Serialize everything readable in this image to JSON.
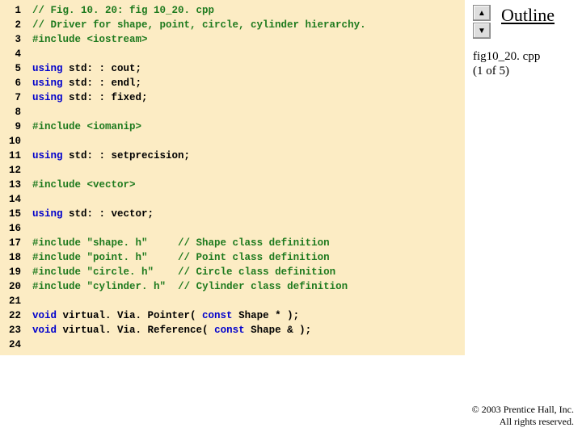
{
  "outline": {
    "title": "Outline",
    "file_label": "fig10_20. cpp",
    "page_label": "(1 of 5)"
  },
  "footer": {
    "copyright": "© 2003 Prentice Hall, Inc.",
    "rights": "All rights reserved."
  },
  "nav": {
    "up_icon": "▲",
    "down_icon": "▼"
  },
  "code": {
    "lines": [
      {
        "n": 1,
        "tokens": [
          {
            "c": "comment",
            "t": "// Fig. 10. 20: fig 10_20. cpp"
          }
        ]
      },
      {
        "n": 2,
        "tokens": [
          {
            "c": "comment",
            "t": "// Driver for shape, point, circle, cylinder hierarchy."
          }
        ]
      },
      {
        "n": 3,
        "tokens": [
          {
            "c": "pp",
            "t": "#include <iostream>"
          }
        ]
      },
      {
        "n": 4,
        "tokens": []
      },
      {
        "n": 5,
        "tokens": [
          {
            "c": "kw",
            "t": "using"
          },
          {
            "c": "plain",
            "t": " std: : cout;"
          }
        ]
      },
      {
        "n": 6,
        "tokens": [
          {
            "c": "kw",
            "t": "using"
          },
          {
            "c": "plain",
            "t": " std: : endl;"
          }
        ]
      },
      {
        "n": 7,
        "tokens": [
          {
            "c": "kw",
            "t": "using"
          },
          {
            "c": "plain",
            "t": " std: : fixed;"
          }
        ]
      },
      {
        "n": 8,
        "tokens": []
      },
      {
        "n": 9,
        "tokens": [
          {
            "c": "pp",
            "t": "#include <iomanip>"
          }
        ]
      },
      {
        "n": 10,
        "tokens": []
      },
      {
        "n": 11,
        "tokens": [
          {
            "c": "kw",
            "t": "using"
          },
          {
            "c": "plain",
            "t": " std: : setprecision;"
          }
        ]
      },
      {
        "n": 12,
        "tokens": []
      },
      {
        "n": 13,
        "tokens": [
          {
            "c": "pp",
            "t": "#include <vector>"
          }
        ]
      },
      {
        "n": 14,
        "tokens": []
      },
      {
        "n": 15,
        "tokens": [
          {
            "c": "kw",
            "t": "using"
          },
          {
            "c": "plain",
            "t": " std: : vector;"
          }
        ]
      },
      {
        "n": 16,
        "tokens": []
      },
      {
        "n": 17,
        "tokens": [
          {
            "c": "pp",
            "t": "#include "
          },
          {
            "c": "str",
            "t": "\"shape. h\""
          },
          {
            "c": "plain",
            "t": "     "
          },
          {
            "c": "comment",
            "t": "// Shape class definition"
          }
        ]
      },
      {
        "n": 18,
        "tokens": [
          {
            "c": "pp",
            "t": "#include "
          },
          {
            "c": "str",
            "t": "\"point. h\""
          },
          {
            "c": "plain",
            "t": "     "
          },
          {
            "c": "comment",
            "t": "// Point class definition"
          }
        ]
      },
      {
        "n": 19,
        "tokens": [
          {
            "c": "pp",
            "t": "#include "
          },
          {
            "c": "str",
            "t": "\"circle. h\""
          },
          {
            "c": "plain",
            "t": "    "
          },
          {
            "c": "comment",
            "t": "// Circle class definition"
          }
        ]
      },
      {
        "n": 20,
        "tokens": [
          {
            "c": "pp",
            "t": "#include "
          },
          {
            "c": "str",
            "t": "\"cylinder. h\""
          },
          {
            "c": "plain",
            "t": "  "
          },
          {
            "c": "comment",
            "t": "// Cylinder class definition"
          }
        ]
      },
      {
        "n": 21,
        "tokens": []
      },
      {
        "n": 22,
        "tokens": [
          {
            "c": "kw",
            "t": "void"
          },
          {
            "c": "plain",
            "t": " virtual. Via. Pointer( "
          },
          {
            "c": "kw",
            "t": "const"
          },
          {
            "c": "plain",
            "t": " Shape * );"
          }
        ]
      },
      {
        "n": 23,
        "tokens": [
          {
            "c": "kw",
            "t": "void"
          },
          {
            "c": "plain",
            "t": " virtual. Via. Reference( "
          },
          {
            "c": "kw",
            "t": "const"
          },
          {
            "c": "plain",
            "t": " Shape & );"
          }
        ]
      },
      {
        "n": 24,
        "tokens": []
      }
    ]
  }
}
